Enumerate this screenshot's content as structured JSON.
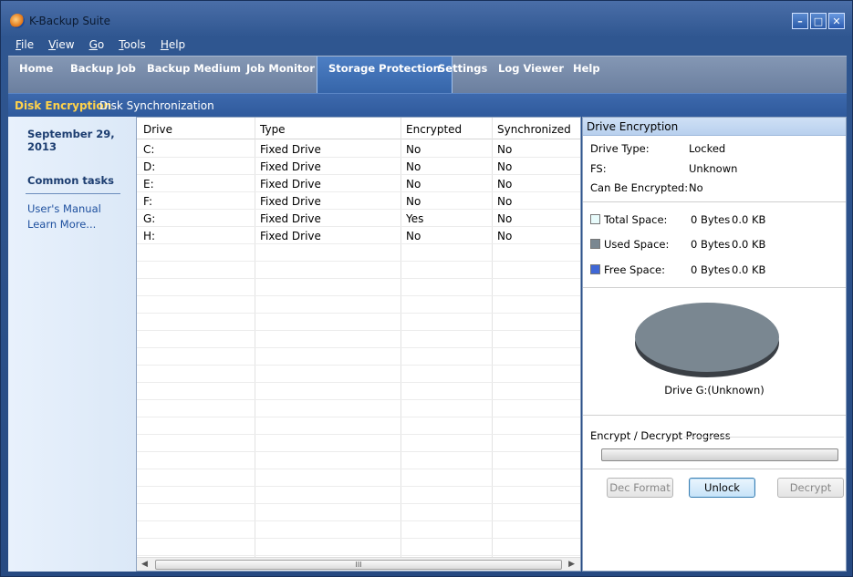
{
  "window": {
    "title": "K-Backup Suite"
  },
  "menu": [
    {
      "label": "File",
      "accel": "F",
      "rest": "ile"
    },
    {
      "label": "View",
      "accel": "V",
      "rest": "iew"
    },
    {
      "label": "Go",
      "accel": "G",
      "rest": "o"
    },
    {
      "label": "Tools",
      "accel": "T",
      "rest": "ools"
    },
    {
      "label": "Help",
      "accel": "H",
      "rest": "elp"
    }
  ],
  "nav": {
    "items": [
      "Home",
      "Backup Job",
      "Backup Medium",
      "Job Monitor",
      "Storage Protection",
      "Settings",
      "Log Viewer",
      "Help"
    ],
    "active": "Storage Protection"
  },
  "subnav": {
    "items": [
      "Disk Encryption",
      "Disk Synchronization"
    ],
    "active": "Disk Encryption"
  },
  "sidebar": {
    "date": "September 29, 2013",
    "common_tasks_title": "Common tasks",
    "links": [
      "User's Manual",
      "Learn More..."
    ]
  },
  "table": {
    "columns": [
      "Drive",
      "Type",
      "Encrypted",
      "Synchronized"
    ],
    "rows": [
      [
        "C:",
        "Fixed Drive",
        "No",
        "No"
      ],
      [
        "D:",
        "Fixed Drive",
        "No",
        "No"
      ],
      [
        "E:",
        "Fixed Drive",
        "No",
        "No"
      ],
      [
        "F:",
        "Fixed Drive",
        "No",
        "No"
      ],
      [
        "G:",
        "Fixed Drive",
        "Yes",
        "No"
      ],
      [
        "H:",
        "Fixed Drive",
        "No",
        "No"
      ]
    ],
    "scroll_grip": "III"
  },
  "drive_panel": {
    "header": "Drive Encryption",
    "props": [
      {
        "label": "Drive Type:",
        "value": "Locked"
      },
      {
        "label": "FS:",
        "value": "Unknown"
      },
      {
        "label": "Can Be Encrypted:",
        "value": "No"
      }
    ],
    "spaces": [
      {
        "label": "Total Space:",
        "bytes": "0 Bytes",
        "kb": "0.0 KB",
        "color": "#e8fbfb"
      },
      {
        "label": "Used Space:",
        "bytes": "0 Bytes",
        "kb": "0.0 KB",
        "color": "#7a8791"
      },
      {
        "label": "Free Space:",
        "bytes": "0 Bytes",
        "kb": "0.0 KB",
        "color": "#3f67d6"
      }
    ],
    "pie_caption": "Drive G:(Unknown)",
    "pie_color": "#7a8791",
    "progress_title": "Encrypt / Decrypt Progress",
    "progress_value": 0,
    "buttons": {
      "dec_format": "Dec Format",
      "unlock": "Unlock",
      "decrypt": "Decrypt"
    }
  }
}
